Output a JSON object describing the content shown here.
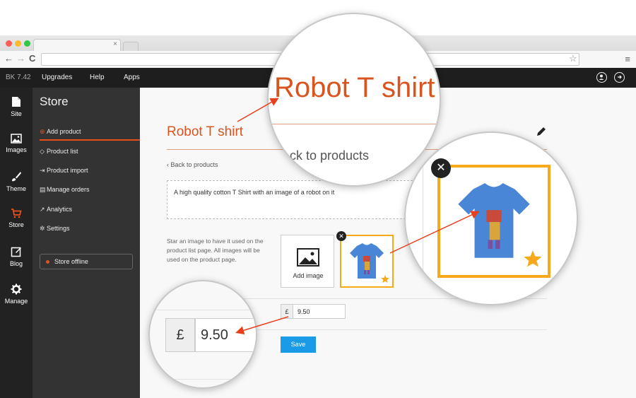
{
  "colors": {
    "accent": "#e8501b",
    "title": "#d9541e",
    "save": "#1a9be8",
    "star": "#f5a91b",
    "rail": "#222222",
    "sidebar": "#333333"
  },
  "browser": {
    "tab_close": "×",
    "back": "←",
    "forward": "→",
    "reload": "C",
    "bookmark_icon": "☆",
    "menu_icon": "≡"
  },
  "appbar": {
    "brand": "BK 7.42",
    "nav": [
      "Upgrades",
      "Help",
      "Apps"
    ]
  },
  "rail": {
    "items": [
      {
        "label": "Site",
        "icon": "page-icon"
      },
      {
        "label": "Images",
        "icon": "image-icon"
      },
      {
        "label": "Theme",
        "icon": "brush-icon"
      },
      {
        "label": "Store",
        "icon": "cart-icon"
      },
      {
        "label": "Blog",
        "icon": "edit-icon"
      },
      {
        "label": "Manage",
        "icon": "gear-icon"
      }
    ]
  },
  "sidebar": {
    "title": "Store",
    "items": [
      {
        "label": "Add product",
        "bullet": "⊕"
      },
      {
        "label": "Product list",
        "bullet": "◇"
      },
      {
        "label": "Product import",
        "bullet": "⇥"
      },
      {
        "label": "Manage orders",
        "bullet": "▤"
      },
      {
        "label": "Analytics",
        "bullet": "↗"
      },
      {
        "label": "Settings",
        "bullet": "✲"
      }
    ],
    "offline": "Store offline"
  },
  "main": {
    "title": "Robot T shirt",
    "back_link": "‹  Back to products",
    "description": "A high quality cotton T Shirt with an image of a robot on it",
    "help_text": "Star an image to have it used on the product list page. All images will be used on the product page.",
    "add_image": "Add image",
    "remove": "✕",
    "price_prefix": "£",
    "price_value": "9.50",
    "save": "Save"
  },
  "zoom": {
    "title": "Robot T shirt",
    "back_fragment": "ck to products",
    "price_prefix": "£",
    "price_value": "9.50",
    "remove": "✕"
  }
}
